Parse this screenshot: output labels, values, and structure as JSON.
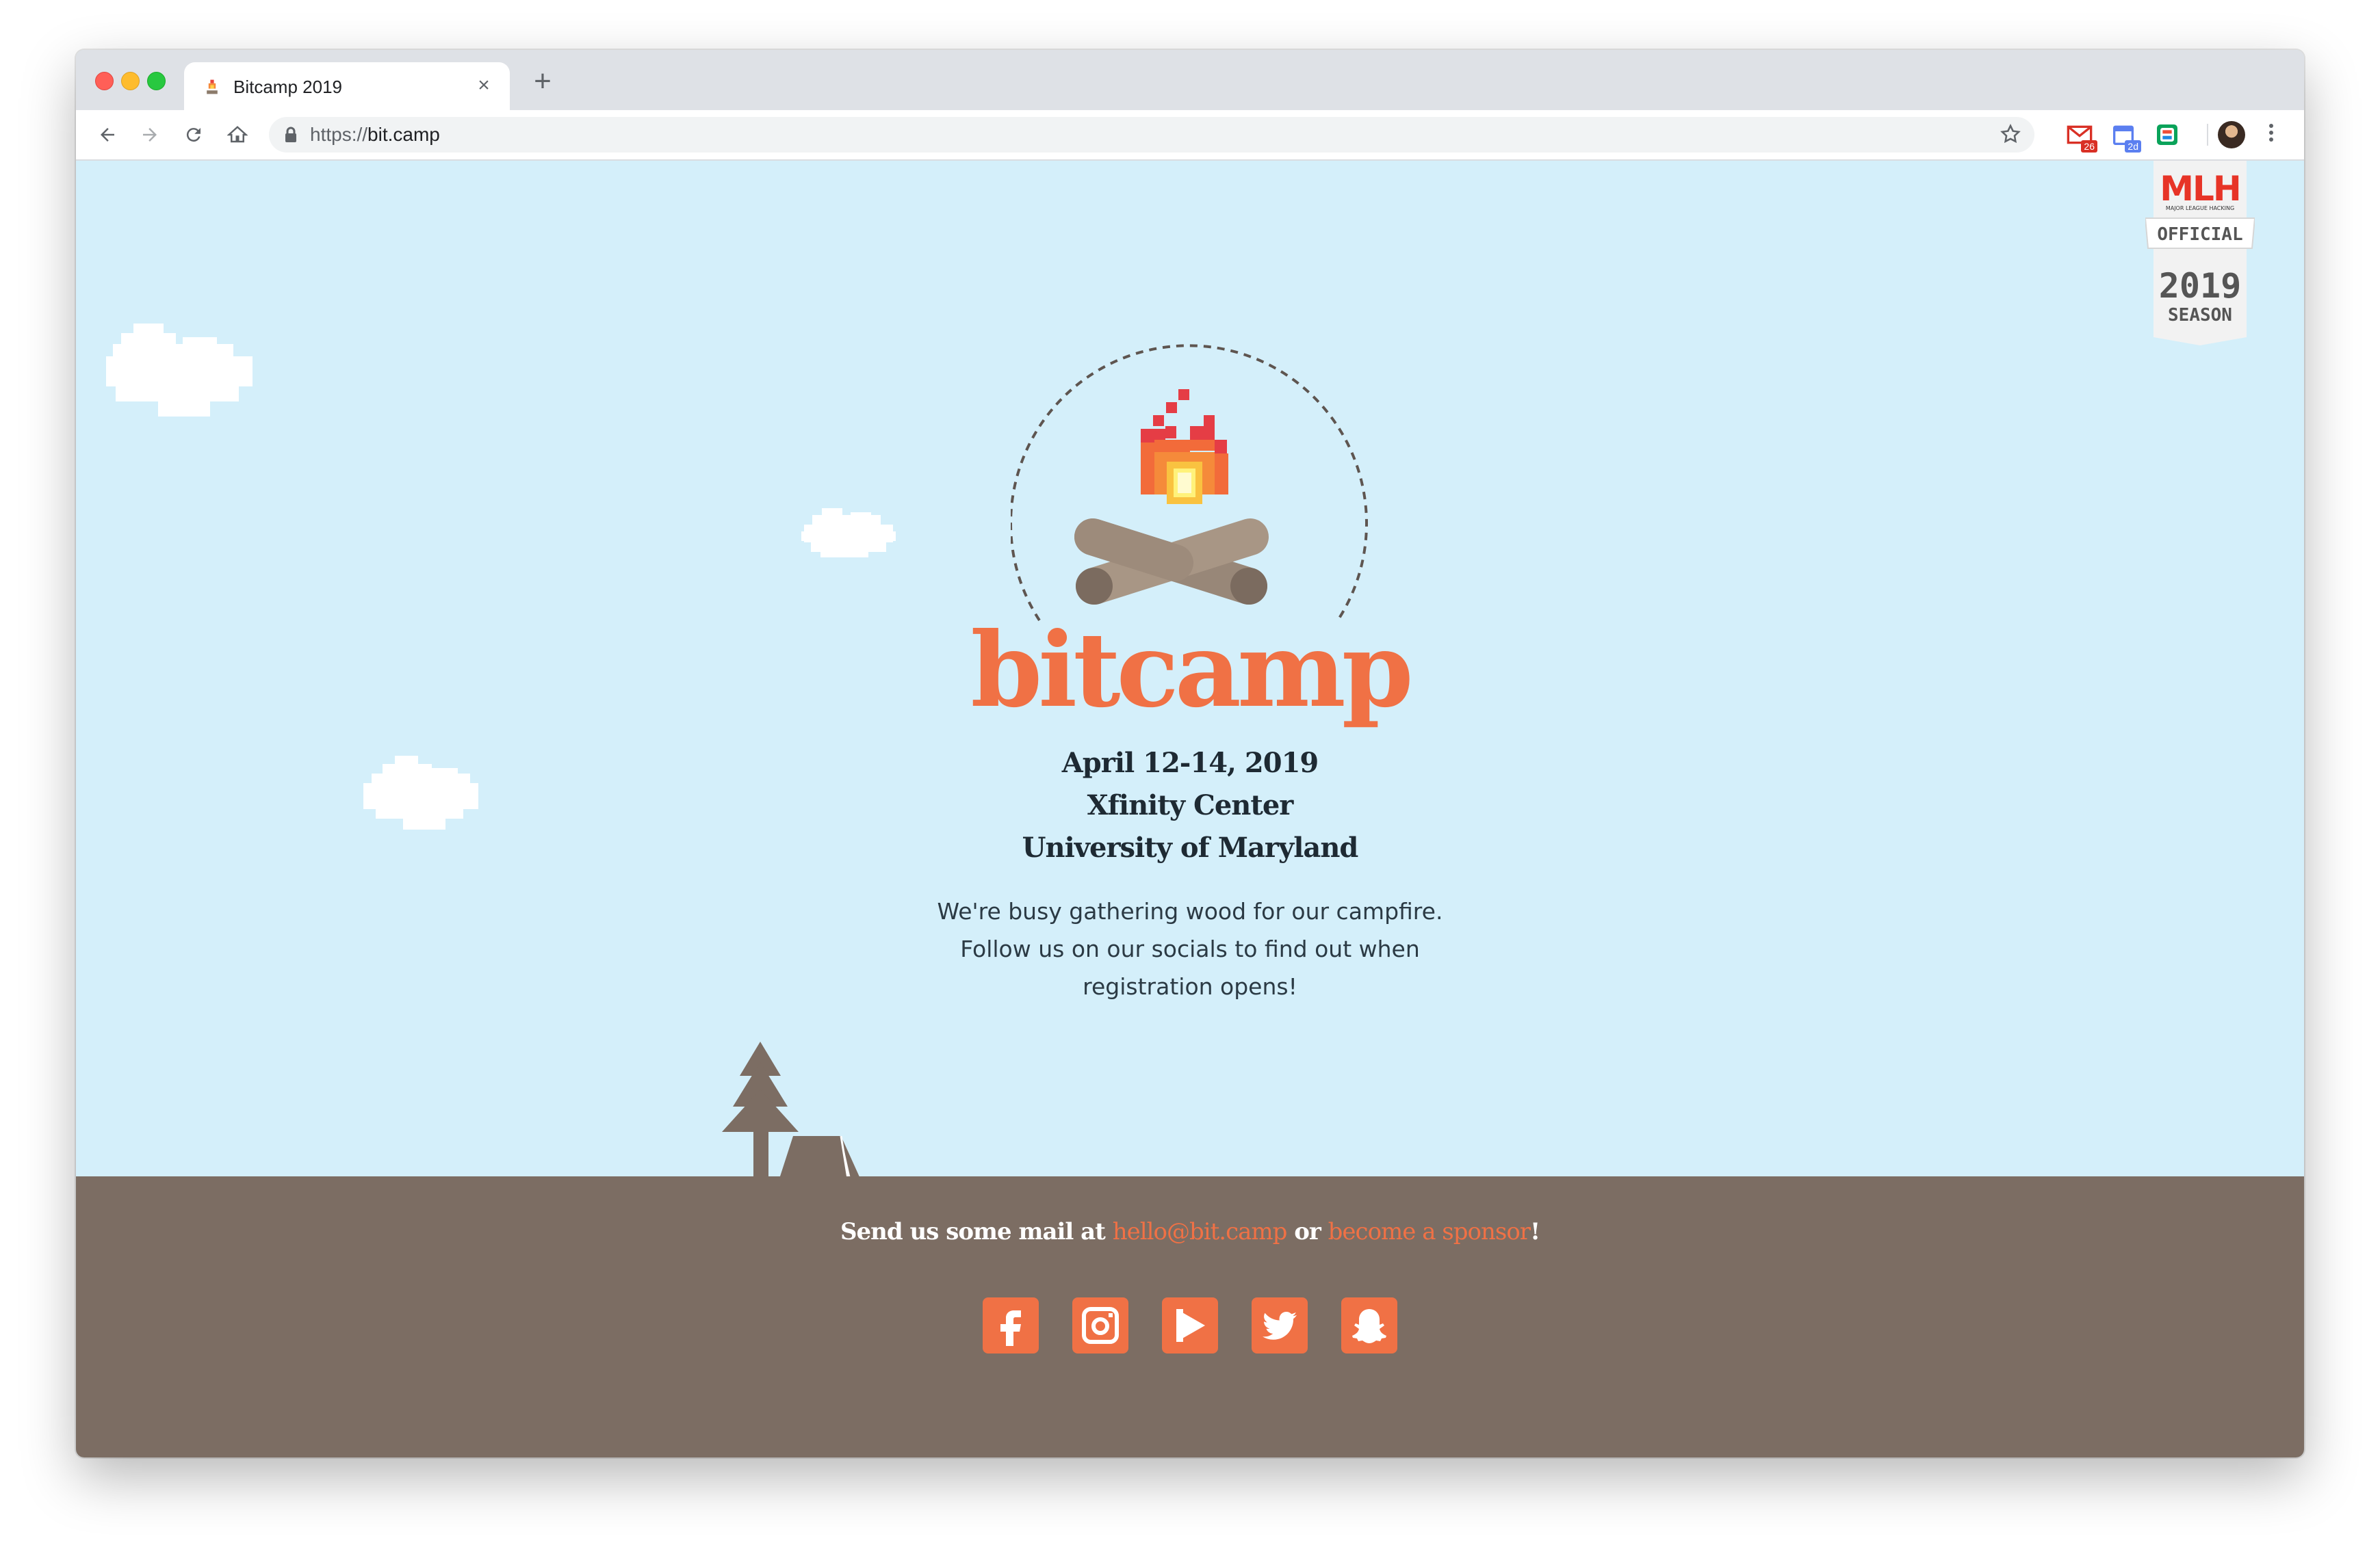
{
  "browser": {
    "tab": {
      "title": "Bitcamp 2019",
      "close_label": "×"
    },
    "new_tab_label": "+",
    "url": {
      "scheme": "https://",
      "host": "bit.camp"
    },
    "extensions": [
      {
        "name": "gmail-extension",
        "badge": "26",
        "color": "#d93025"
      },
      {
        "name": "calendar-extension",
        "badge": "2d",
        "color": "#5b7ff0"
      },
      {
        "name": "stackshare-extension",
        "badge": "",
        "color": "#0aa35a"
      }
    ]
  },
  "page": {
    "logo_text": "bitcamp",
    "event": {
      "date": "April 12-14, 2019",
      "venue": "Xfinity Center",
      "university": "University of Maryland"
    },
    "blurb": [
      "We're busy gathering wood for our campfire.",
      "Follow us on our socials to find out when",
      "registration opens!"
    ],
    "mail": {
      "prefix": "Send us some mail at ",
      "email": "hello@bit.camp",
      "middle": " or ",
      "sponsor": "become a sponsor",
      "suffix": "!"
    },
    "socials": [
      "facebook-icon",
      "instagram-icon",
      "play-icon",
      "twitter-icon",
      "snapchat-icon"
    ],
    "mlh_badge": {
      "logo": "MLH",
      "tagline": "MAJOR LEAGUE HACKING",
      "official": "OFFICIAL",
      "year": "2019",
      "season": "SEASON"
    },
    "colors": {
      "sky": "#d4effa",
      "ground": "#7c6d63",
      "accent": "#f07145",
      "text": "#1e2a33"
    }
  }
}
